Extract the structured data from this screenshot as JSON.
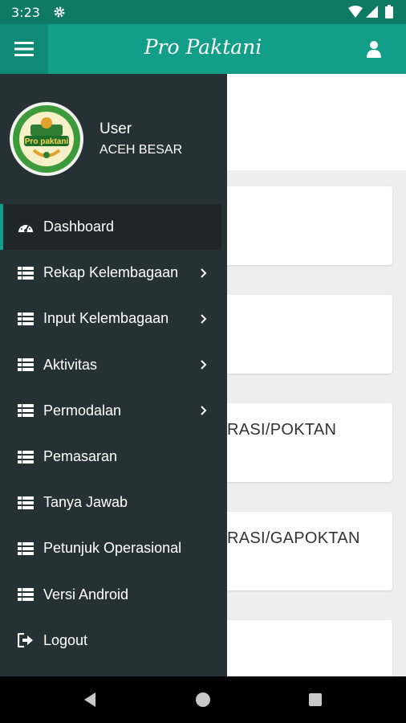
{
  "status_bar": {
    "time": "3:23"
  },
  "app_bar": {
    "title": "Pro Paktani"
  },
  "drawer": {
    "user_name": "User",
    "user_region": "ACEH BESAR",
    "items": [
      {
        "label": "Dashboard",
        "icon": "dashboard-icon",
        "has_submenu": false,
        "active": true
      },
      {
        "label": "Rekap Kelembagaan",
        "icon": "list-icon",
        "has_submenu": true
      },
      {
        "label": "Input Kelembagaan",
        "icon": "list-icon",
        "has_submenu": true
      },
      {
        "label": "Aktivitas",
        "icon": "list-icon",
        "has_submenu": true
      },
      {
        "label": "Permodalan",
        "icon": "list-icon",
        "has_submenu": true
      },
      {
        "label": "Pemasaran",
        "icon": "list-icon",
        "has_submenu": false
      },
      {
        "label": "Tanya Jawab",
        "icon": "list-icon",
        "has_submenu": false
      },
      {
        "label": "Petunjuk Operasional",
        "icon": "list-icon",
        "has_submenu": false
      },
      {
        "label": "Versi Android",
        "icon": "list-icon",
        "has_submenu": false
      },
      {
        "label": "Logout",
        "icon": "logout-icon",
        "has_submenu": false
      }
    ]
  },
  "content": {
    "cards": [
      {
        "text": ""
      },
      {
        "text": ""
      },
      {
        "text": "RASI/POKTAN"
      },
      {
        "text": "RASI/GAPOKTAN"
      },
      {
        "text": ""
      }
    ]
  },
  "colors": {
    "primary": "#129e89",
    "status_bar": "#0e7a66",
    "drawer_bg": "#263136",
    "active_item": "#1e262a"
  }
}
